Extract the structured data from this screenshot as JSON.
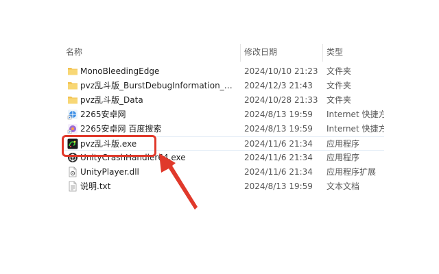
{
  "columns": {
    "name": "名称",
    "date": "修改日期",
    "type": "类型"
  },
  "files": [
    {
      "icon": "folder-icon",
      "name": "MonoBleedingEdge",
      "date": "2024/10/10 21:23",
      "type": "文件夹"
    },
    {
      "icon": "folder-icon",
      "name": "pvz乱斗版_BurstDebugInformation_D...",
      "date": "2024/12/3 21:43",
      "type": "文件夹"
    },
    {
      "icon": "folder-icon",
      "name": "pvz乱斗版_Data",
      "date": "2024/10/28 21:33",
      "type": "文件夹"
    },
    {
      "icon": "internet-shortcut-icon",
      "name": "2265安卓网",
      "date": "2024/8/13 19:59",
      "type": "Internet 快捷方式"
    },
    {
      "icon": "internet-shortcut-icon",
      "name": "2265安卓网 百度搜索",
      "date": "2024/8/13 19:59",
      "type": "Internet 快捷方式"
    },
    {
      "icon": "game-exe-icon",
      "name": "pvz乱斗版.exe",
      "date": "2024/11/6 21:34",
      "type": "应用程序"
    },
    {
      "icon": "unity-exe-icon",
      "name": "UnityCrashHandler64.exe",
      "date": "2024/11/6 21:34",
      "type": "应用程序"
    },
    {
      "icon": "dll-icon",
      "name": "UnityPlayer.dll",
      "date": "2024/11/6 21:34",
      "type": "应用程序扩展"
    },
    {
      "icon": "text-file-icon",
      "name": "说明.txt",
      "date": "2024/8/13 19:59",
      "type": "文本文档"
    }
  ],
  "highlight_color": "#e0392b"
}
